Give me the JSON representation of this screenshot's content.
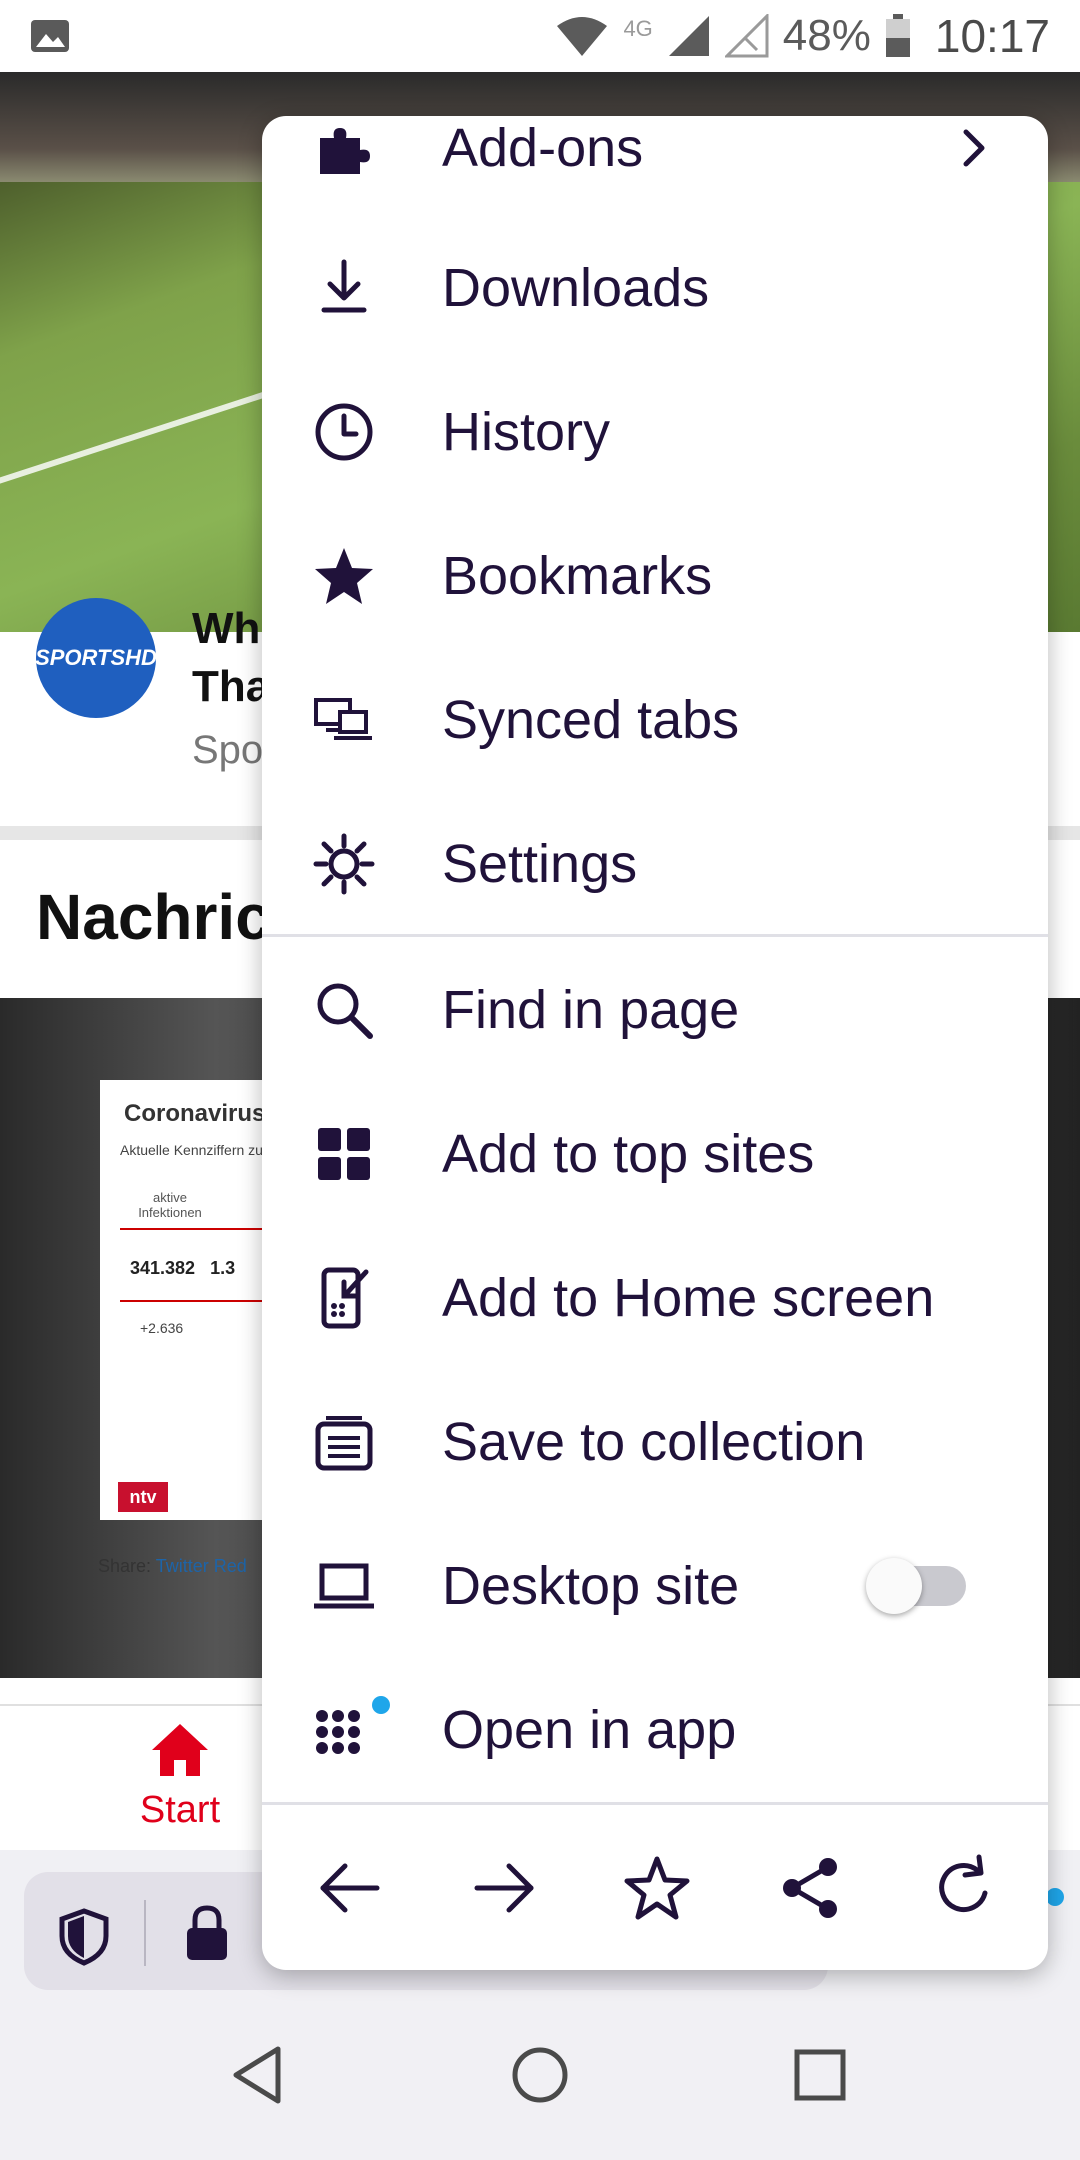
{
  "status_bar": {
    "network": "4G",
    "battery": "48%",
    "time": "10:17"
  },
  "background": {
    "card": {
      "title_line1": "Wh",
      "title_line2": "Tha",
      "source": "Spo",
      "logo_text": "SPORTSHD"
    },
    "section_title": "Nachric",
    "news_image": {
      "title": "Coronavirus",
      "subtitle": "Aktuelle Kennziffern zu",
      "label": "aktive Infektionen",
      "value": "341.382",
      "value2": "1.3",
      "delta": "+2.636",
      "logo": "ntv",
      "share_label": "Share:",
      "share_twitter": "Twitter",
      "share_reddit": "Red"
    },
    "bottom_nav": {
      "start_label": "Start"
    }
  },
  "menu": {
    "items": [
      {
        "label": "Add-ons",
        "icon": "puzzle-icon"
      },
      {
        "label": "Downloads",
        "icon": "download-icon"
      },
      {
        "label": "History",
        "icon": "clock-icon"
      },
      {
        "label": "Bookmarks",
        "icon": "star-filled-icon"
      },
      {
        "label": "Synced tabs",
        "icon": "synced-tabs-icon"
      },
      {
        "label": "Settings",
        "icon": "gear-icon"
      },
      {
        "label": "Find in page",
        "icon": "search-icon"
      },
      {
        "label": "Add to top sites",
        "icon": "top-sites-icon"
      },
      {
        "label": "Add to Home screen",
        "icon": "add-home-screen-icon"
      },
      {
        "label": "Save to collection",
        "icon": "collection-icon"
      },
      {
        "label": "Desktop site",
        "icon": "laptop-icon",
        "toggle_on": false
      },
      {
        "label": "Open in app",
        "icon": "apps-grid-icon"
      }
    ],
    "bottom_actions": [
      "back-arrow-icon",
      "forward-arrow-icon",
      "star-outline-icon",
      "share-icon",
      "reload-icon"
    ]
  },
  "colors": {
    "menu_text": "#20123a",
    "accent_red": "#e0001b",
    "badge_blue": "#1fa6ea"
  }
}
